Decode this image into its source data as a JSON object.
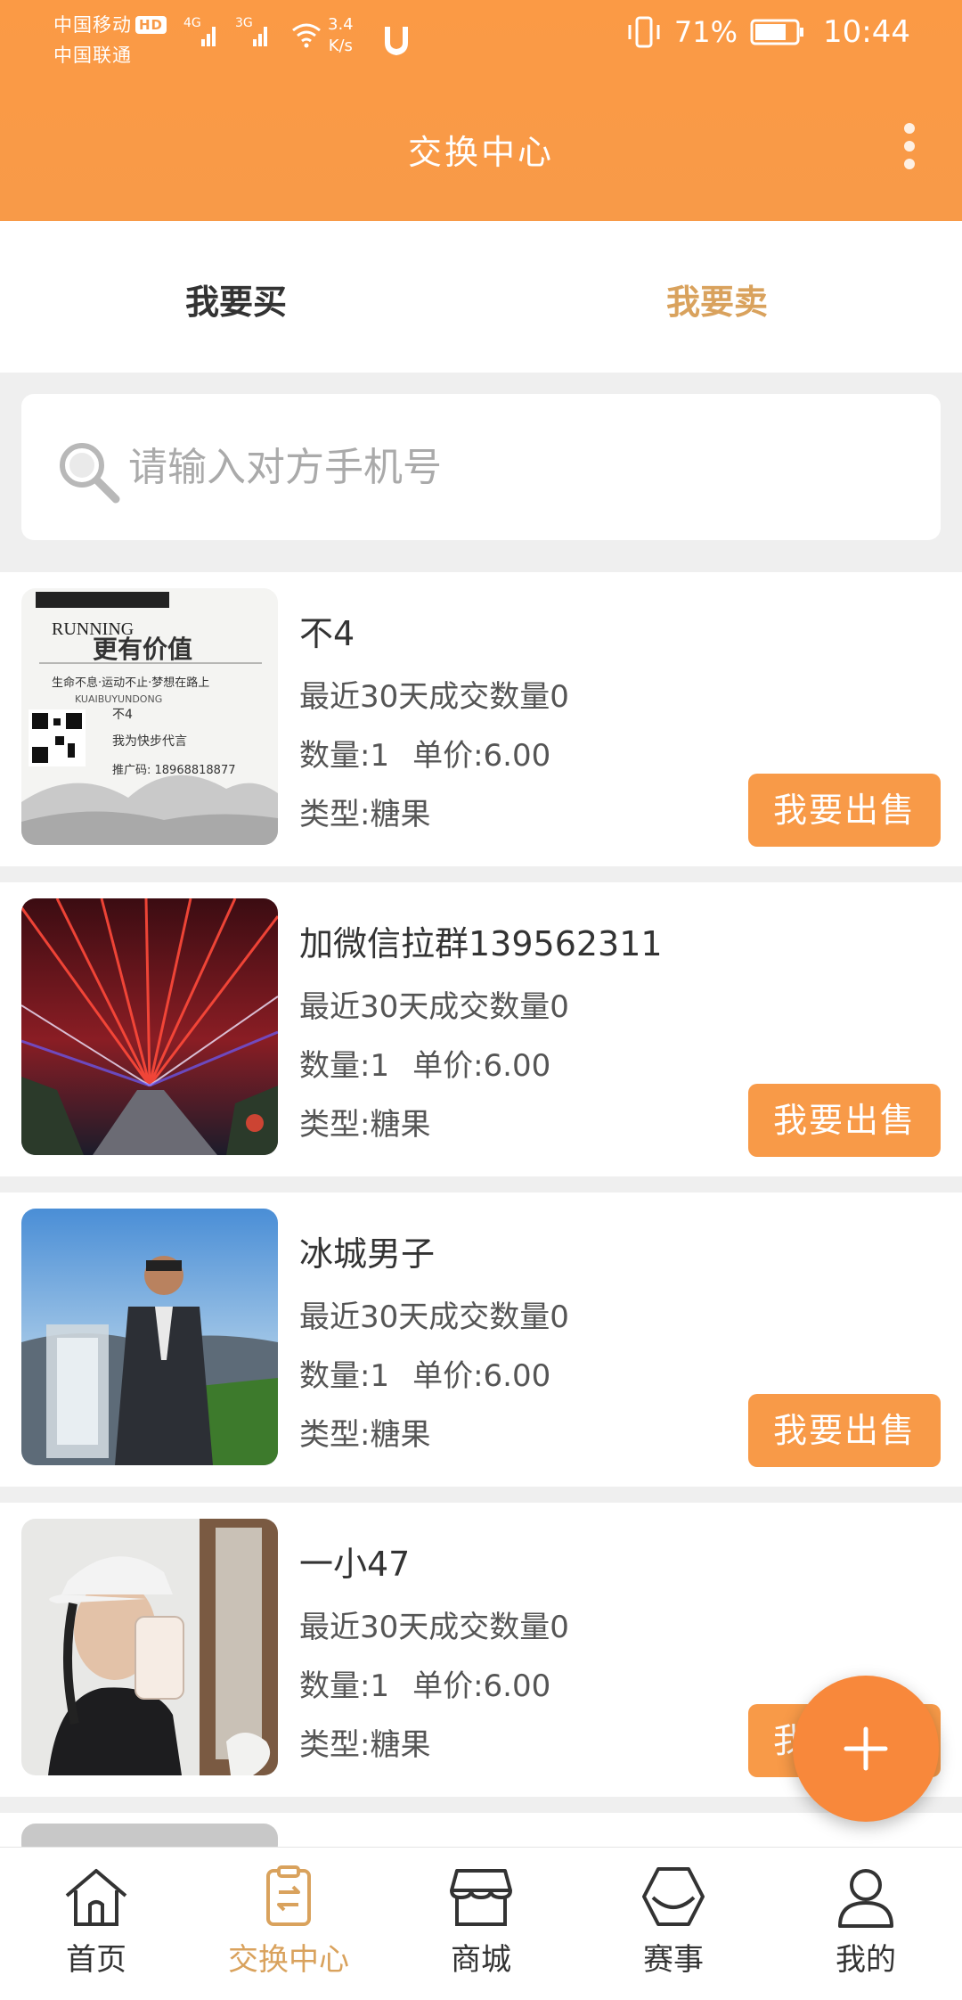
{
  "status_bar": {
    "carrier1": "中国移动",
    "carrier1_badge": "HD",
    "carrier2": "中国联通",
    "signal1_tag": "4G",
    "signal2_tag": "3G",
    "net_speed_value": "3.4",
    "net_speed_unit": "K/s",
    "battery": "71%",
    "time": "10:44"
  },
  "header": {
    "title": "交换中心"
  },
  "tabs": [
    {
      "label": "我要买",
      "active": false
    },
    {
      "label": "我要卖",
      "active": true
    }
  ],
  "search": {
    "placeholder": "请输入对方手机号"
  },
  "listings": [
    {
      "name": "不4",
      "recent": "最近30天成交数量0",
      "quantity": "数量:1",
      "price": "单价:6.00",
      "type": "类型:糖果",
      "button": "我要出售"
    },
    {
      "name": "加微信拉群139562311",
      "recent": "最近30天成交数量0",
      "quantity": "数量:1",
      "price": "单价:6.00",
      "type": "类型:糖果",
      "button": "我要出售"
    },
    {
      "name": "冰城男子",
      "recent": "最近30天成交数量0",
      "quantity": "数量:1",
      "price": "单价:6.00",
      "type": "类型:糖果",
      "button": "我要出售"
    },
    {
      "name": "一小47",
      "recent": "最近30天成交数量0",
      "quantity": "数量:1",
      "price": "单价:6.00",
      "type": "类型:糖果",
      "button": "我要出售"
    }
  ],
  "thumb1_text": {
    "running": "RUNNING",
    "slogan": "更有价值",
    "motto": "生命不息·运动不止·梦想在路上",
    "pinyin": "KUAIBUYUNDONG",
    "user": "不4",
    "endorse": "我为快步代言",
    "promo": "推广码: 18968818877"
  },
  "bottom_nav": [
    {
      "label": "首页",
      "icon": "home-icon",
      "active": false
    },
    {
      "label": "交换中心",
      "icon": "exchange-icon",
      "active": true
    },
    {
      "label": "商城",
      "icon": "shop-icon",
      "active": false
    },
    {
      "label": "赛事",
      "icon": "event-icon",
      "active": false
    },
    {
      "label": "我的",
      "icon": "profile-icon",
      "active": false
    }
  ],
  "colors": {
    "accent": "#f89a48",
    "active_tab": "#d9a25d",
    "background": "#efefef"
  }
}
